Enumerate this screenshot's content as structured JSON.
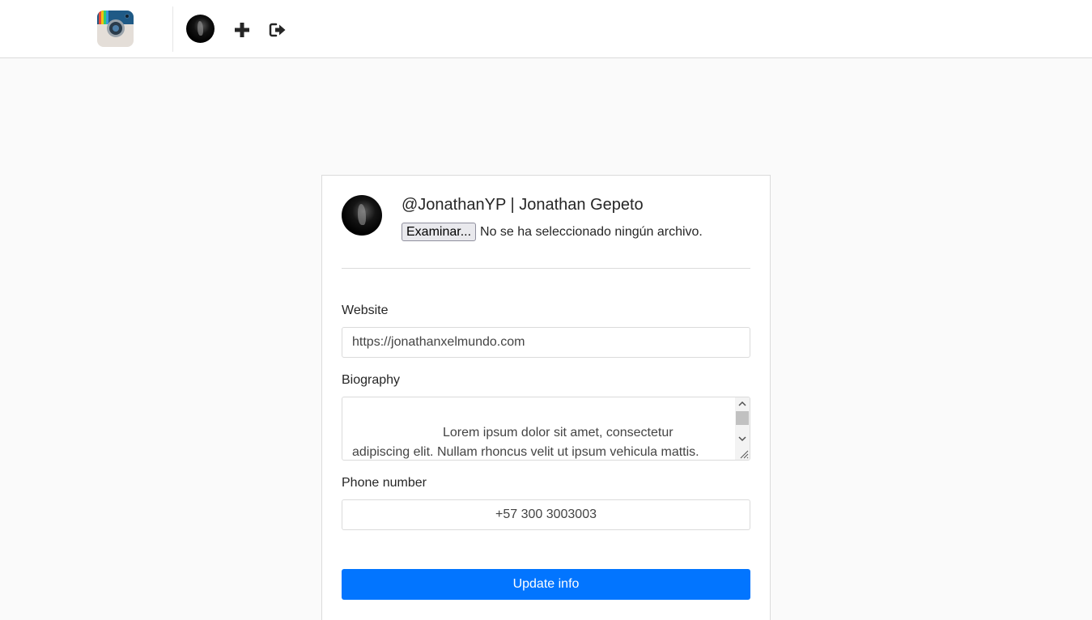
{
  "navbar": {
    "logo_colors": [
      "#e74c3c",
      "#f1c40f",
      "#2ecc71",
      "#3498db"
    ],
    "icons": [
      "instagram-logo",
      "avatar",
      "plus-icon",
      "logout-icon"
    ]
  },
  "profile": {
    "title": "@JonathanYP | Jonathan Gepeto",
    "file_button": "Examinar...",
    "file_status": "No se ha seleccionado ningún archivo."
  },
  "form": {
    "website_label": "Website",
    "website_value": "https://jonathanxelmundo.com",
    "biography_label": "Biography",
    "biography_value": "Lorem ipsum dolor sit amet, consectetur adipiscing elit. Nullam rhoncus velit ut ipsum vehicula mattis.",
    "phone_label": "Phone number",
    "phone_value": "+57 300 3003003",
    "submit_label": "Update info"
  },
  "colors": {
    "accent": "#0275ff",
    "border": "#dbdbdb",
    "background": "#fafafa"
  }
}
